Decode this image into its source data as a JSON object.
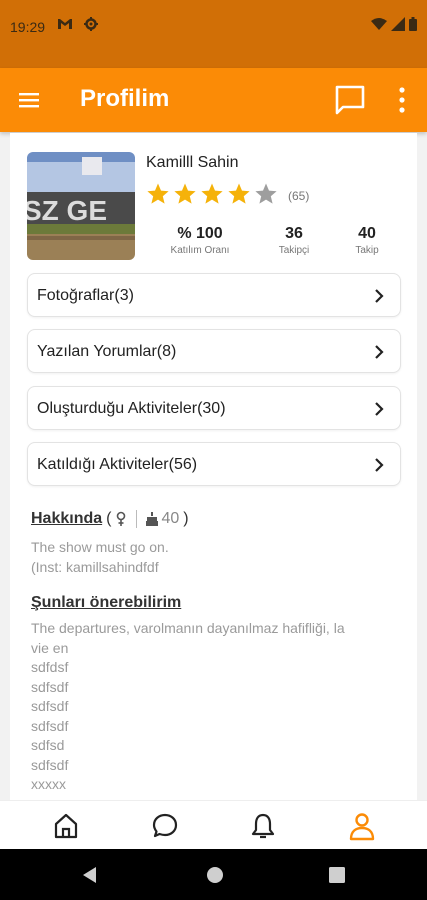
{
  "status_bar": {
    "time": "19:29",
    "icons": [
      "gmail-icon",
      "settings-gear-icon",
      "wifi-icon",
      "signal-icon",
      "battery-icon"
    ]
  },
  "app_bar": {
    "title": "Profilim",
    "color": "#fb8b06",
    "icons": [
      "menu-icon",
      "chat-icon",
      "more-vertical-icon"
    ]
  },
  "profile": {
    "name": "Kamilll Sahin",
    "rating": 4,
    "rating_max": 5,
    "rating_count": "(65)",
    "stats": [
      {
        "value": "% 100",
        "label": "Katılım Oranı"
      },
      {
        "value": "36",
        "label": "Takipçi"
      },
      {
        "value": "40",
        "label": "Takip"
      }
    ]
  },
  "menu_items": [
    {
      "label": "Fotoğraflar(3)"
    },
    {
      "label": "Yazılan Yorumlar(8)"
    },
    {
      "label": "Oluşturduğu Aktiviteler(30)"
    },
    {
      "label": "Katıldığı Aktiviteler(56)"
    }
  ],
  "about": {
    "title": "Hakkında",
    "open_paren": "(",
    "close_paren": ")",
    "gender_icon": "female-icon",
    "age_icon": "cake-icon",
    "age": "40",
    "lines": [
      "The show must go on.",
      "(Inst: kamillsahindfdf"
    ]
  },
  "recommend": {
    "title": "Şunları önerebilirim",
    "lines": [
      "The departures, varolmanın dayanılmaz hafifliği, la",
      "vie en",
      "sdfdsf",
      "sdfsdf",
      "sdfsdf",
      "sdfsdf",
      "sdfsd",
      "sdfsdf",
      "xxxxx"
    ]
  },
  "bottom_nav": {
    "items": [
      "home-icon",
      "chat-bubble-icon",
      "bell-icon",
      "profile-icon"
    ],
    "active": "profile-icon",
    "active_color": "#fb8b06"
  },
  "system_nav": [
    "back-icon",
    "home-circle-icon",
    "recents-icon"
  ]
}
